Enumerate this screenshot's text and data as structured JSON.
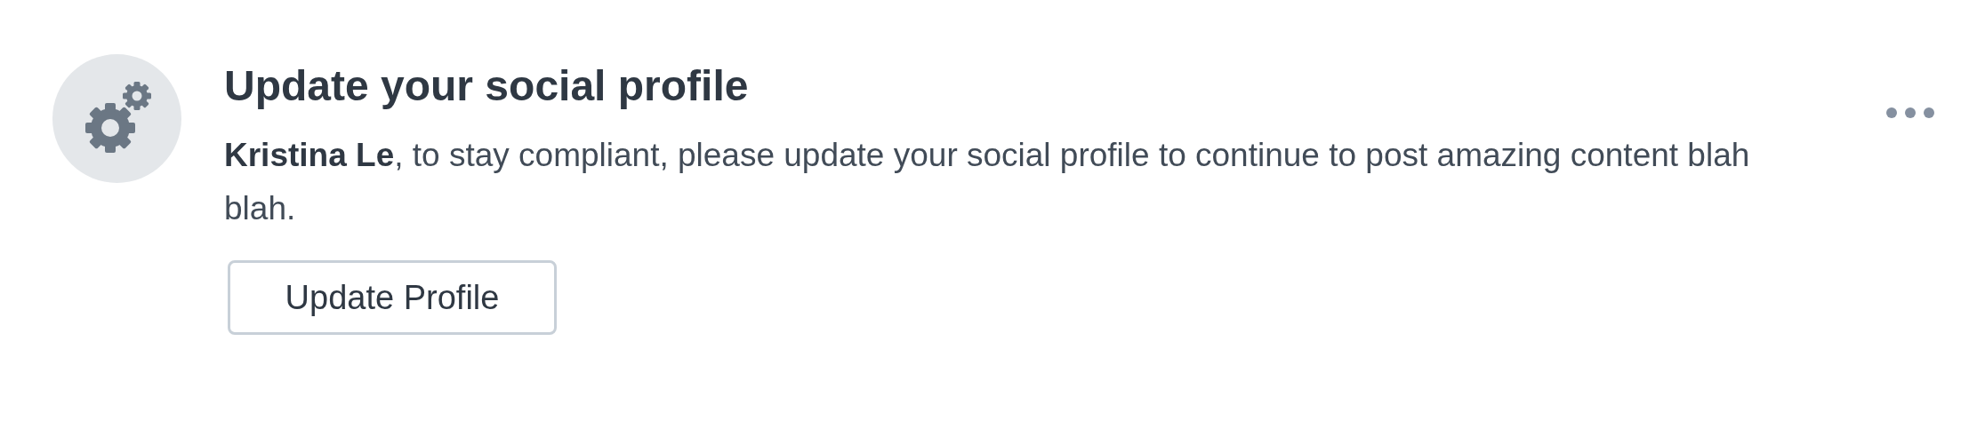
{
  "notification": {
    "title": "Update your social profile",
    "message": "**Kristina Le**, to stay compliant, please update your social profile to continue to post amazing content blah blah.",
    "button": "Update Profile"
  }
}
